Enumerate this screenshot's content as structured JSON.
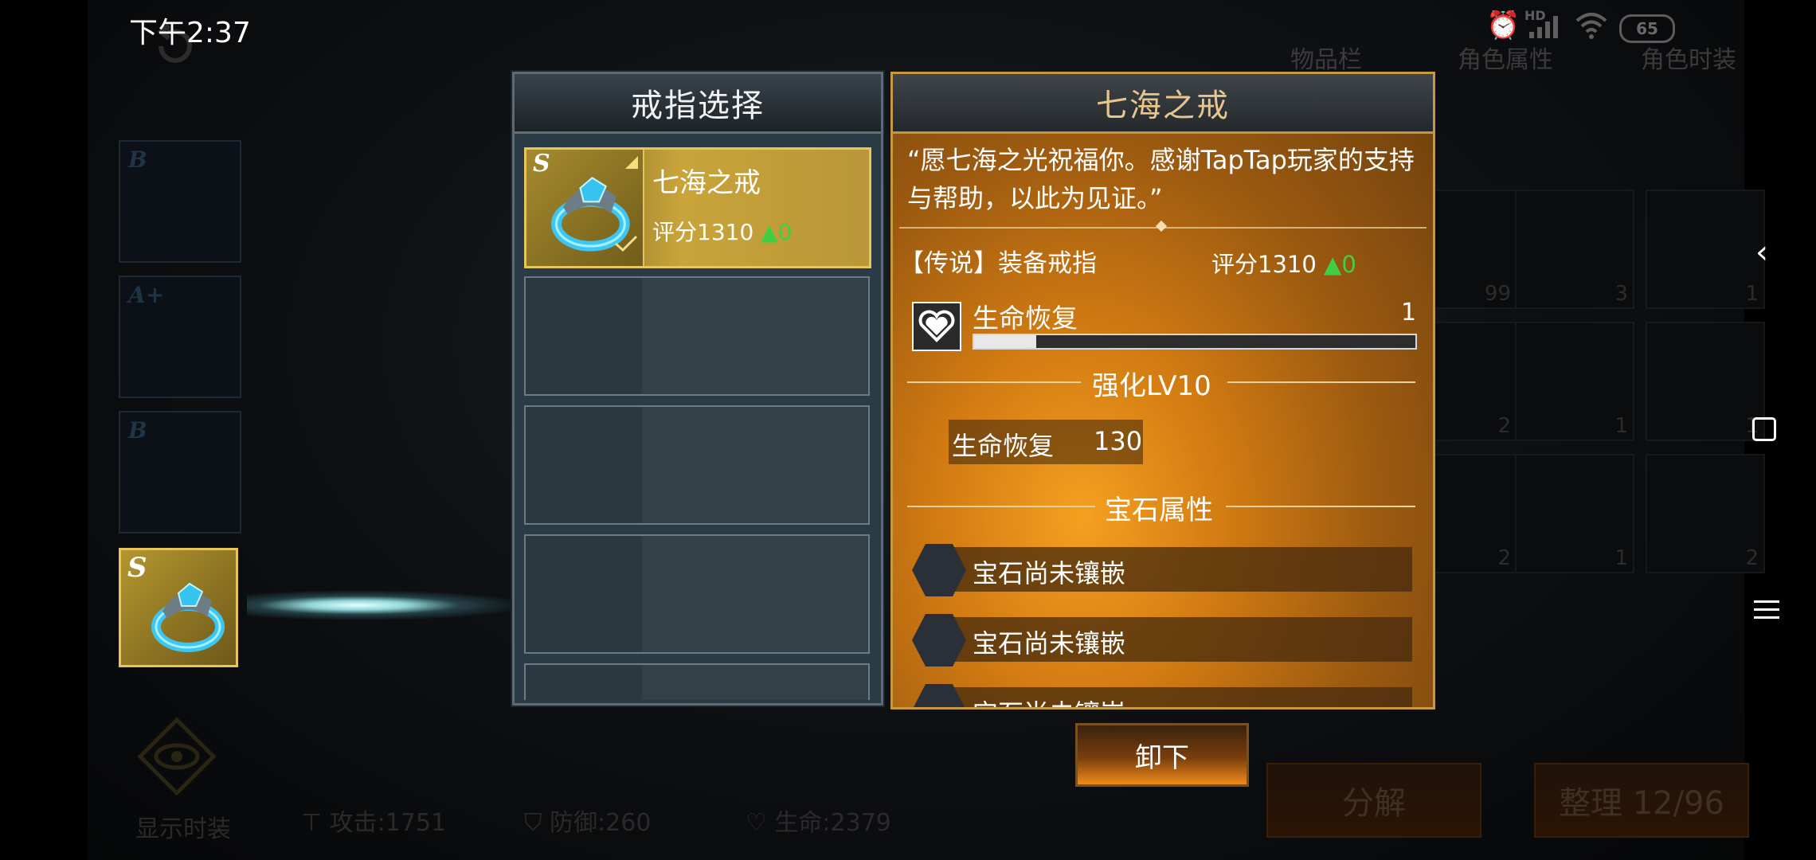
{
  "status_bar": {
    "time": "下午2:37",
    "battery": "65",
    "hd_label": "HD"
  },
  "background": {
    "tabs": [
      "物品栏",
      "角色属性",
      "角色时装"
    ],
    "equip_grades": [
      "B",
      "A+",
      "B",
      "S"
    ],
    "show_fashion_label": "显示时装",
    "stats": {
      "attack": "攻击:1751",
      "defense": "防御:260",
      "life": "生命:2379"
    },
    "inventory_counts": [
      "99",
      "3",
      "1",
      "2",
      "1",
      "1",
      "2",
      "1",
      "2"
    ],
    "decompose_label": "分解",
    "arrange_label": "整理 12/96"
  },
  "ring_panel": {
    "title": "戒指选择",
    "selected_ring": {
      "grade": "S",
      "name": "七海之戒",
      "score_label": "评分1310",
      "score_delta": "▲0"
    },
    "empty_slot_count": 4
  },
  "detail_panel": {
    "title": "七海之戒",
    "quote": "“愿七海之光祝福你。感谢TapTap玩家的支持与帮助，以此为见证。”",
    "rarity_type": "【传说】装备戒指",
    "score_label": "评分1310",
    "score_delta": "▲0",
    "main_stat": {
      "name": "生命恢复",
      "value": "1",
      "fill_fraction": 0.14
    },
    "strength_title": "强化LV10",
    "strength_stat": {
      "name": "生命恢复",
      "value": "130"
    },
    "gem_title": "宝石属性",
    "gem_slots": [
      "宝石尚未镶嵌",
      "宝石尚未镶嵌",
      "宝石尚未镶嵌"
    ]
  },
  "unequip_label": "卸下",
  "colors": {
    "gold_accent": "#e7c55a",
    "detail_orange": "#d07a12",
    "up_green": "#3fcf45"
  }
}
